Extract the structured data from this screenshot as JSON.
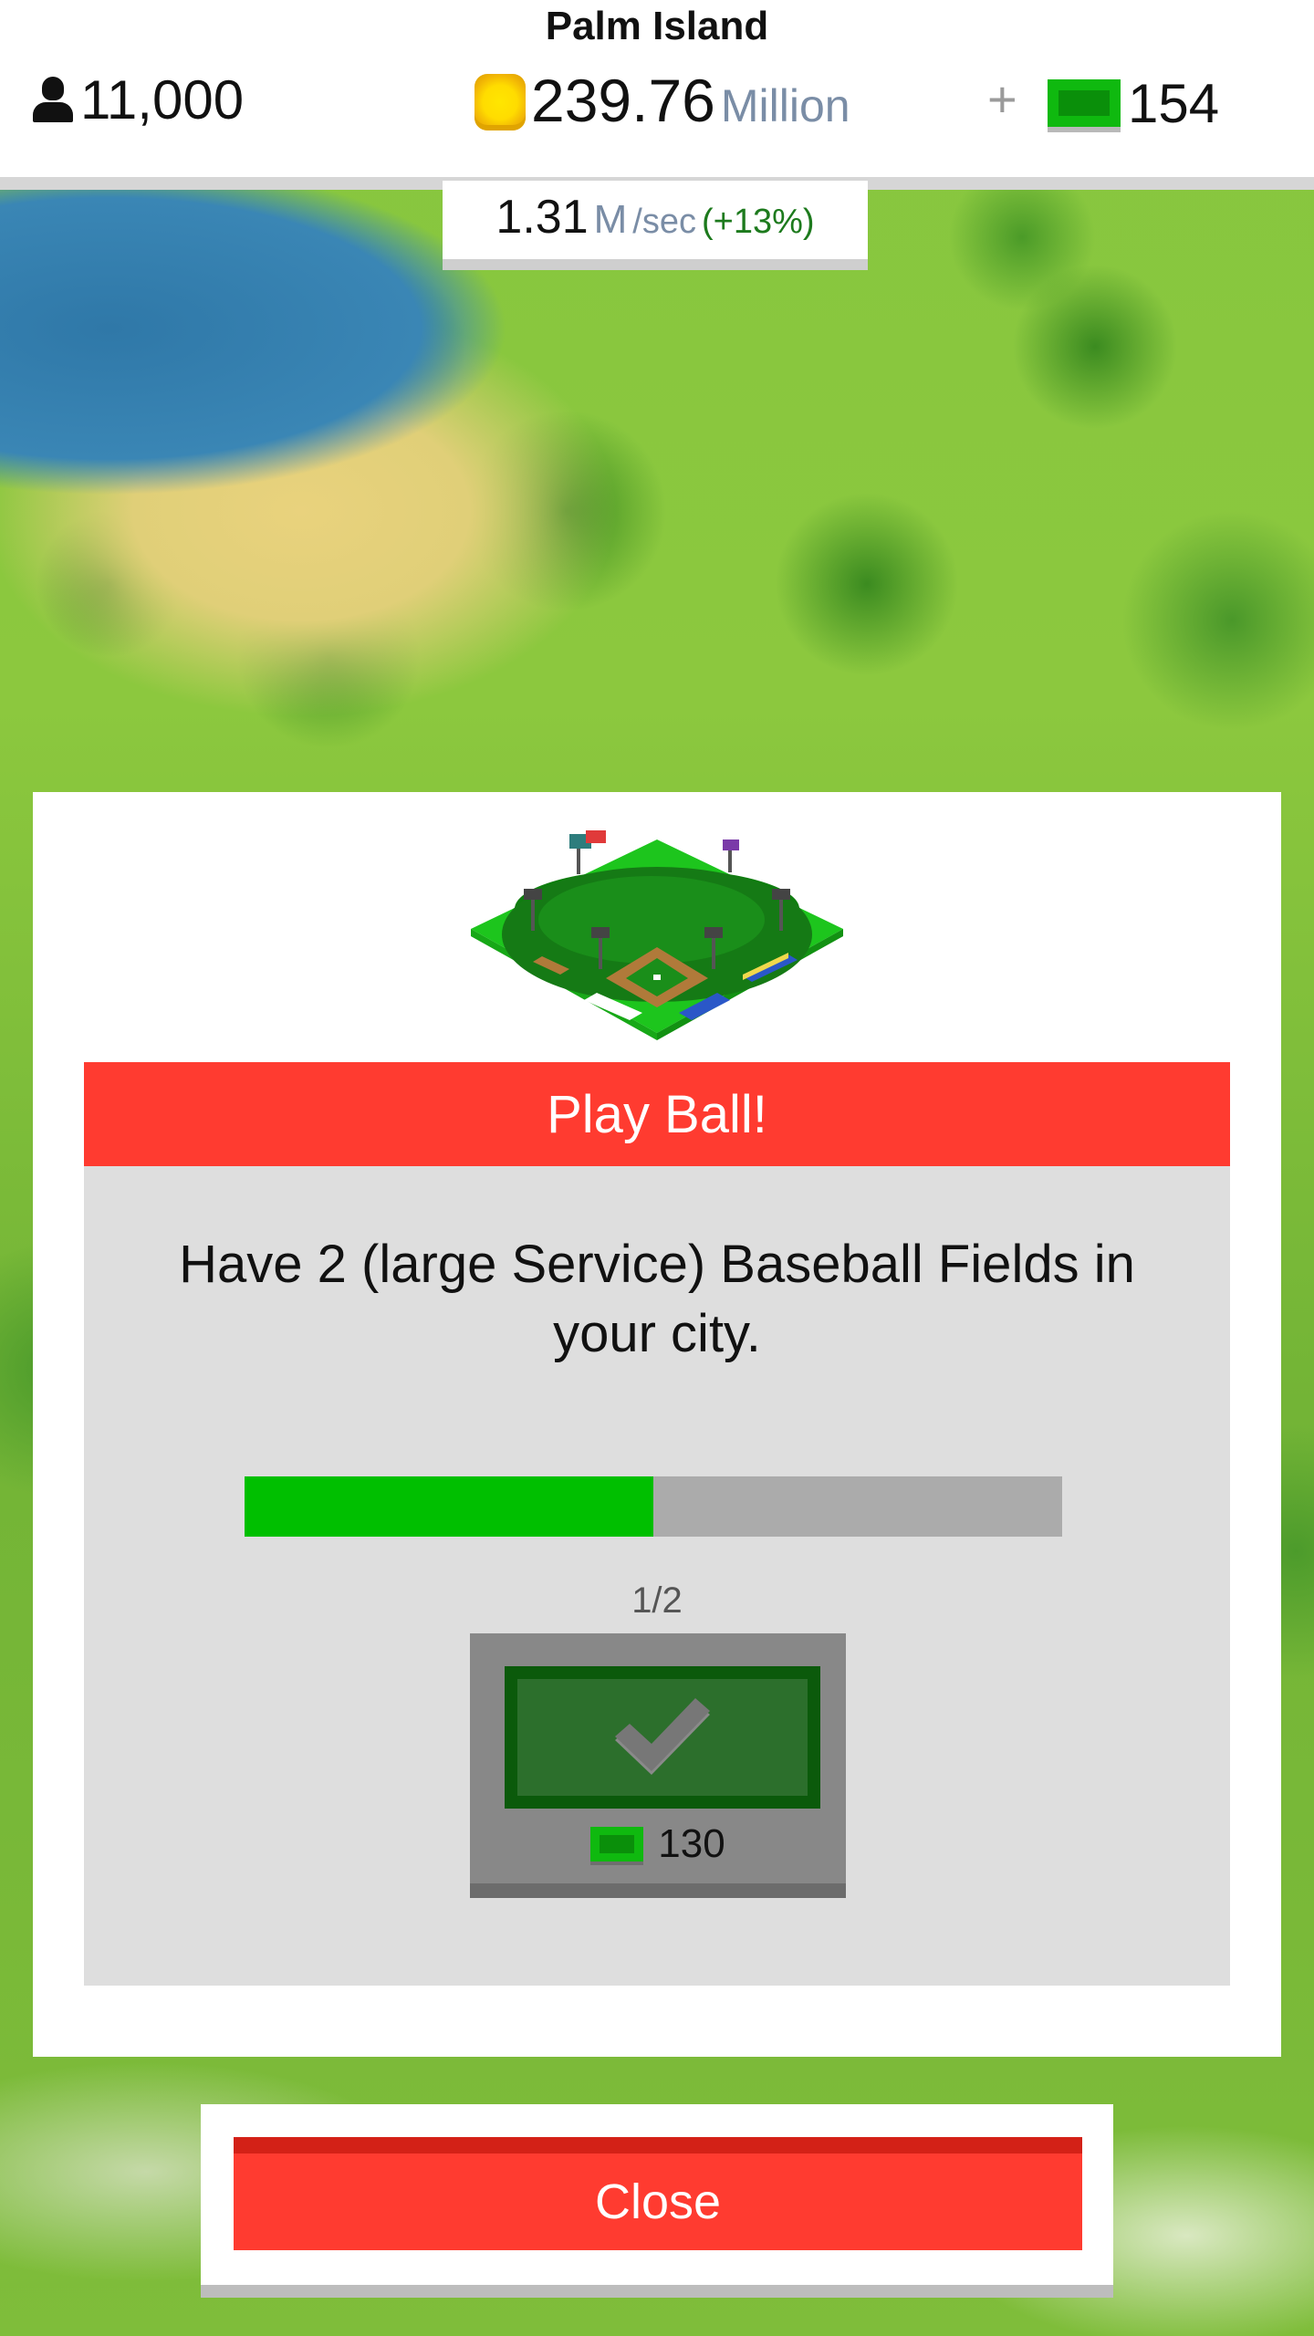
{
  "header": {
    "city_name": "Palm Island",
    "population": "11,000",
    "money_value": "239.76",
    "money_unit": "Million",
    "plus": "+",
    "cash": "154",
    "icons": {
      "population": "person-icon",
      "money": "coin-icon",
      "cash": "cash-icon"
    }
  },
  "income": {
    "value": "1.31",
    "unit": "M",
    "rate": "/sec",
    "bonus": "(+13%)"
  },
  "achievement": {
    "title": "Play Ball!",
    "description": "Have 2 (large Service) Baseball Fields in your city.",
    "progress_label": "1/2",
    "progress_fraction": 0.5,
    "reward_value": "130",
    "icons": {
      "image": "baseball-field-icon",
      "claim": "check-icon",
      "reward": "cash-icon"
    }
  },
  "footer": {
    "close_label": "Close"
  },
  "colors": {
    "accent_red": "#ff3b30",
    "progress_green": "#00bf00",
    "cash_green": "#0fb90f",
    "coin_yellow": "#ffdc00"
  }
}
